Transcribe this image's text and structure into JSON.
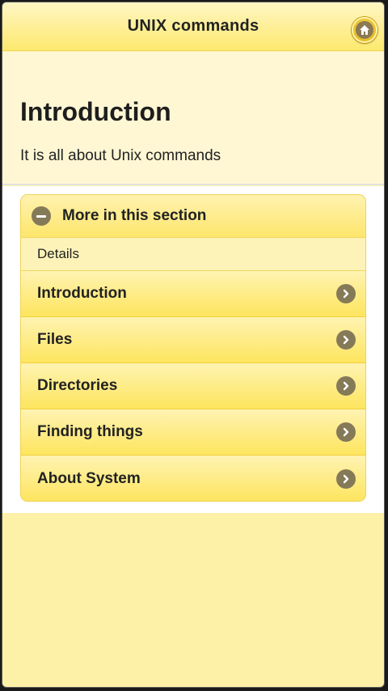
{
  "header": {
    "title": "UNIX commands",
    "home_icon": "home-icon"
  },
  "intro": {
    "title": "Introduction",
    "text": "It is all about Unix commands"
  },
  "section": {
    "heading": "More in this section",
    "toggle_icon": "minus-icon",
    "divider": "Details",
    "items": [
      {
        "label": "Introduction",
        "icon": "chevron-right-icon"
      },
      {
        "label": "Files",
        "icon": "chevron-right-icon"
      },
      {
        "label": "Directories",
        "icon": "chevron-right-icon"
      },
      {
        "label": "Finding things",
        "icon": "chevron-right-icon"
      },
      {
        "label": "About System",
        "icon": "chevron-right-icon"
      }
    ]
  },
  "colors": {
    "header": "#fde96f",
    "page_background": "#fdf1a8",
    "icon": "#857a58"
  }
}
